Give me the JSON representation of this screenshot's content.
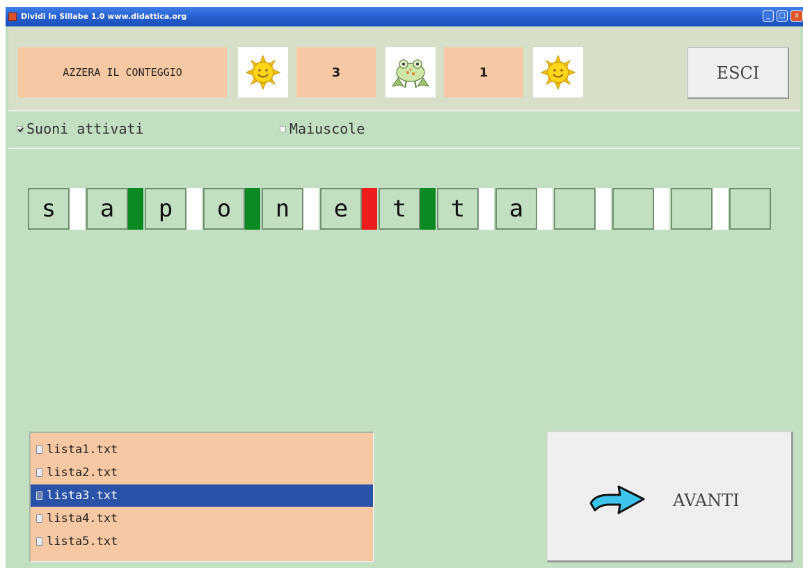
{
  "window": {
    "title": "Dividi In Sillabe 1.0   www.didattica.org",
    "controls": {
      "minimize": "_",
      "maximize": "□",
      "close": "x"
    }
  },
  "toolbar": {
    "reset_label": "AZZERA IL CONTEGGIO",
    "correct_icon": "sun-smiley-icon",
    "correct_count": "3",
    "wrong_icon": "frog-icon",
    "wrong_count": "1",
    "status_icon": "sun-smiley-icon",
    "exit_label": "ESCI"
  },
  "options": {
    "sounds_label": "Suoni attivati",
    "sounds_checked": true,
    "uppercase_label": "Maiuscole",
    "uppercase_checked": false
  },
  "word": {
    "letters": [
      "s",
      "a",
      "p",
      "o",
      "n",
      "e",
      "t",
      "t",
      "a",
      "",
      "",
      "",
      ""
    ],
    "separators": [
      "white",
      "green",
      "white",
      "green",
      "white",
      "red",
      "green",
      "white",
      "white",
      "white",
      "white",
      "white"
    ],
    "colors": {
      "neutral": "#ffffff",
      "correct": "#0b8a24",
      "wrong": "#ee1c1c"
    }
  },
  "file_list": {
    "items": [
      "lista1.txt",
      "lista2.txt",
      "lista3.txt",
      "lista4.txt",
      "lista5.txt"
    ],
    "selected_index": 2
  },
  "next_button": {
    "label": "AVANTI",
    "icon": "arrow-right-icon"
  }
}
